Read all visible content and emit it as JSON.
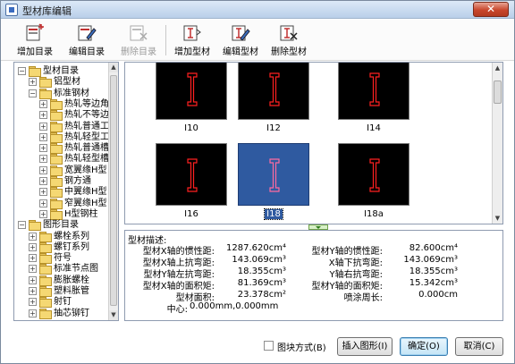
{
  "window": {
    "title": "型材库编辑",
    "close_glyph": "✕"
  },
  "toolbar": {
    "buttons": [
      {
        "label": "增加目录",
        "icon": "add-folder-icon",
        "enabled": true
      },
      {
        "label": "编辑目录",
        "icon": "edit-folder-icon",
        "enabled": true
      },
      {
        "label": "删除目录",
        "icon": "delete-folder-icon",
        "enabled": false
      },
      {
        "label": "增加型材",
        "icon": "add-section-icon",
        "enabled": true
      },
      {
        "label": "编辑型材",
        "icon": "edit-section-icon",
        "enabled": true
      },
      {
        "label": "删除型材",
        "icon": "delete-section-icon",
        "enabled": true
      }
    ]
  },
  "tree": {
    "nodes": [
      {
        "label": "型材目录",
        "toggle": "−",
        "depth": 0
      },
      {
        "label": "铝型材",
        "toggle": "+",
        "depth": 1
      },
      {
        "label": "标准钢材",
        "toggle": "−",
        "depth": 1
      },
      {
        "label": "热轧等边角",
        "toggle": "+",
        "depth": 2
      },
      {
        "label": "热轧不等边",
        "toggle": "+",
        "depth": 2
      },
      {
        "label": "热轧普通工",
        "toggle": "+",
        "depth": 2
      },
      {
        "label": "热轧轻型工",
        "toggle": "+",
        "depth": 2
      },
      {
        "label": "热轧普通槽",
        "toggle": "+",
        "depth": 2
      },
      {
        "label": "热轧轻型槽",
        "toggle": "+",
        "depth": 2
      },
      {
        "label": "宽翼缘H型",
        "toggle": "+",
        "depth": 2
      },
      {
        "label": "钢方通",
        "toggle": "+",
        "depth": 2
      },
      {
        "label": "中翼缘H型",
        "toggle": "+",
        "depth": 2
      },
      {
        "label": "窄翼缘H型",
        "toggle": "+",
        "depth": 2
      },
      {
        "label": "H型钢柱",
        "toggle": "+",
        "depth": 2
      },
      {
        "label": "图形目录",
        "toggle": "−",
        "depth": 0
      },
      {
        "label": "螺栓系列",
        "toggle": "+",
        "depth": 1
      },
      {
        "label": "螺钉系列",
        "toggle": "+",
        "depth": 1
      },
      {
        "label": "符号",
        "toggle": "+",
        "depth": 1
      },
      {
        "label": "标准节点图",
        "toggle": "+",
        "depth": 1
      },
      {
        "label": "膨胀螺栓",
        "toggle": "+",
        "depth": 1
      },
      {
        "label": "塑料胀管",
        "toggle": "+",
        "depth": 1
      },
      {
        "label": "射钉",
        "toggle": "+",
        "depth": 1
      },
      {
        "label": "抽芯铆钉",
        "toggle": "+",
        "depth": 1
      }
    ]
  },
  "gallery": {
    "items": [
      {
        "label": "I10",
        "selected": false
      },
      {
        "label": "I12",
        "selected": false
      },
      {
        "label": "I14",
        "selected": false
      },
      {
        "label": "I16",
        "selected": false
      },
      {
        "label": "I18",
        "selected": true
      },
      {
        "label": "I18a",
        "selected": false
      }
    ],
    "colors": {
      "tile_bg": "#000000",
      "selected_bg": "#2f5aa0",
      "outline": "#ff2020",
      "selected_outline": "#ff6aa0"
    }
  },
  "info": {
    "heading": "型材描述:",
    "left": [
      {
        "label": "型材X轴的惯性距:",
        "value": "1287.620cm⁴"
      },
      {
        "label": "型材X轴上抗弯距:",
        "value": "143.069cm³"
      },
      {
        "label": "型材Y轴左抗弯距:",
        "value": "18.355cm³"
      },
      {
        "label": "型材X轴的面积矩:",
        "value": "81.369cm³"
      },
      {
        "label": "型材面积:",
        "value": "23.378cm²"
      }
    ],
    "right": [
      {
        "label": "型材Y轴的惯性距:",
        "value": "82.600cm⁴"
      },
      {
        "label": "X轴下抗弯距:",
        "value": "143.069cm³"
      },
      {
        "label": "Y轴右抗弯距:",
        "value": "18.355cm³"
      },
      {
        "label": "型材Y轴的面积矩:",
        "value": "15.342cm³"
      },
      {
        "label": "喷涂周长:",
        "value": "0.000cm"
      }
    ],
    "center": {
      "label": "中心:",
      "value": "0.000mm,0.000mm"
    }
  },
  "footer": {
    "block_mode_label": "图块方式(B)",
    "insert_label": "插入图形(I)",
    "ok_label": "确定(O)",
    "cancel_label": "取消(C)"
  }
}
